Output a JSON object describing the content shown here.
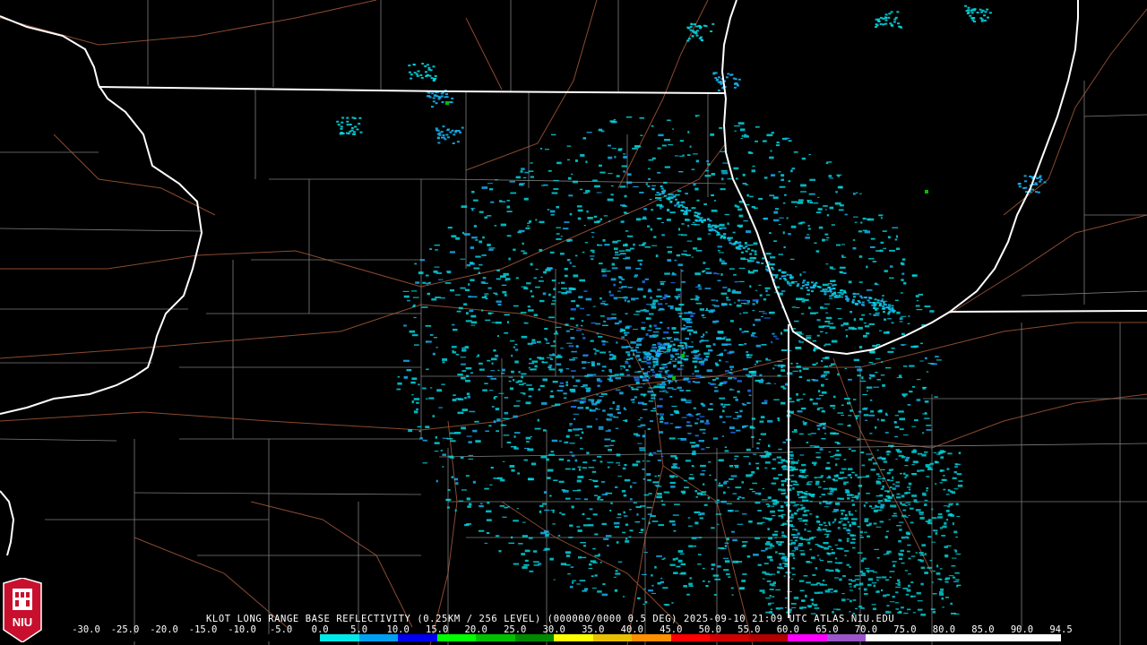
{
  "product": {
    "caption": "KLOT LONG RANGE BASE REFLECTIVITY (0.25KM / 256 LEVEL) (000000/0000 0.5 DEG) 2025-09-10 21:09 UTC  ATLAS.NIU.EDU"
  },
  "legend": {
    "unit_values": [
      "-30.0",
      "-25.0",
      "-20.0",
      "-15.0",
      "-10.0",
      "-5.0",
      "0.0",
      "5.0",
      "10.0",
      "15.0",
      "20.0",
      "25.0",
      "30.0",
      "35.0",
      "40.0",
      "45.0",
      "50.0",
      "55.0",
      "60.0",
      "65.0",
      "70.0",
      "75.0",
      "80.0",
      "85.0",
      "90.0",
      "94.5"
    ],
    "colors": [
      "#000000",
      "#000000",
      "#000000",
      "#000000",
      "#000000",
      "#000000",
      "#00e8e8",
      "#00a0f0",
      "#0000f0",
      "#00ff00",
      "#00c000",
      "#008800",
      "#ffff00",
      "#e8c000",
      "#ff9000",
      "#ff0000",
      "#d00000",
      "#b00000",
      "#ff00ff",
      "#9955c9",
      "#ffffff",
      "#ffffff",
      "#ffffff",
      "#ffffff",
      "#ffffff"
    ]
  },
  "logo": {
    "text": "NIU"
  },
  "map_style": {
    "background": "#000000",
    "state_border_color": "#ffffff",
    "county_border_color": "#8a8a8a",
    "road_color": "#8b4a2f",
    "echo_colors": [
      "#00d8e0",
      "#18b0f0",
      "#1f6ff0",
      "#00c000"
    ]
  }
}
